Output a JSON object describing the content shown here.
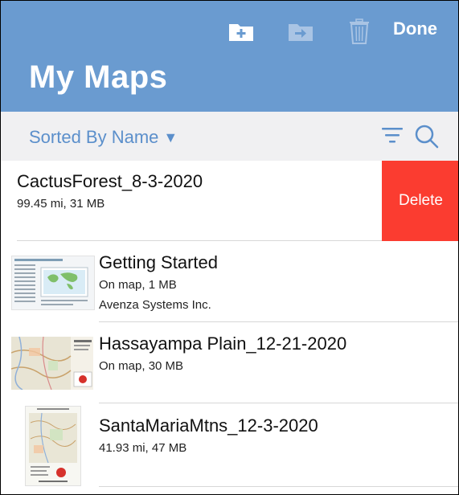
{
  "header": {
    "done_label": "Done",
    "title": "My Maps",
    "toolbar_icons": [
      "new-folder-icon",
      "move-to-folder-icon",
      "trash-icon"
    ],
    "background": "#6a9bd0"
  },
  "sortbar": {
    "sort_label": "Sorted By Name",
    "sort_arrow": "▼",
    "icons": [
      "filter-icon",
      "search-icon"
    ],
    "accent": "#5b8fcb"
  },
  "maps": [
    {
      "title": "CactusForest_8-3-2020",
      "subtitle": "99.45 mi, 31 MB",
      "delete_label": "Delete"
    },
    {
      "title": "Getting Started",
      "subtitle": "On map, 1 MB",
      "publisher": "Avenza Systems Inc."
    },
    {
      "title": "Hassayampa Plain_12-21-2020",
      "subtitle": "On map, 30 MB"
    },
    {
      "title": "SantaMariaMtns_12-3-2020",
      "subtitle": "41.93 mi, 47 MB"
    }
  ],
  "delete_color": "#fb3c30"
}
